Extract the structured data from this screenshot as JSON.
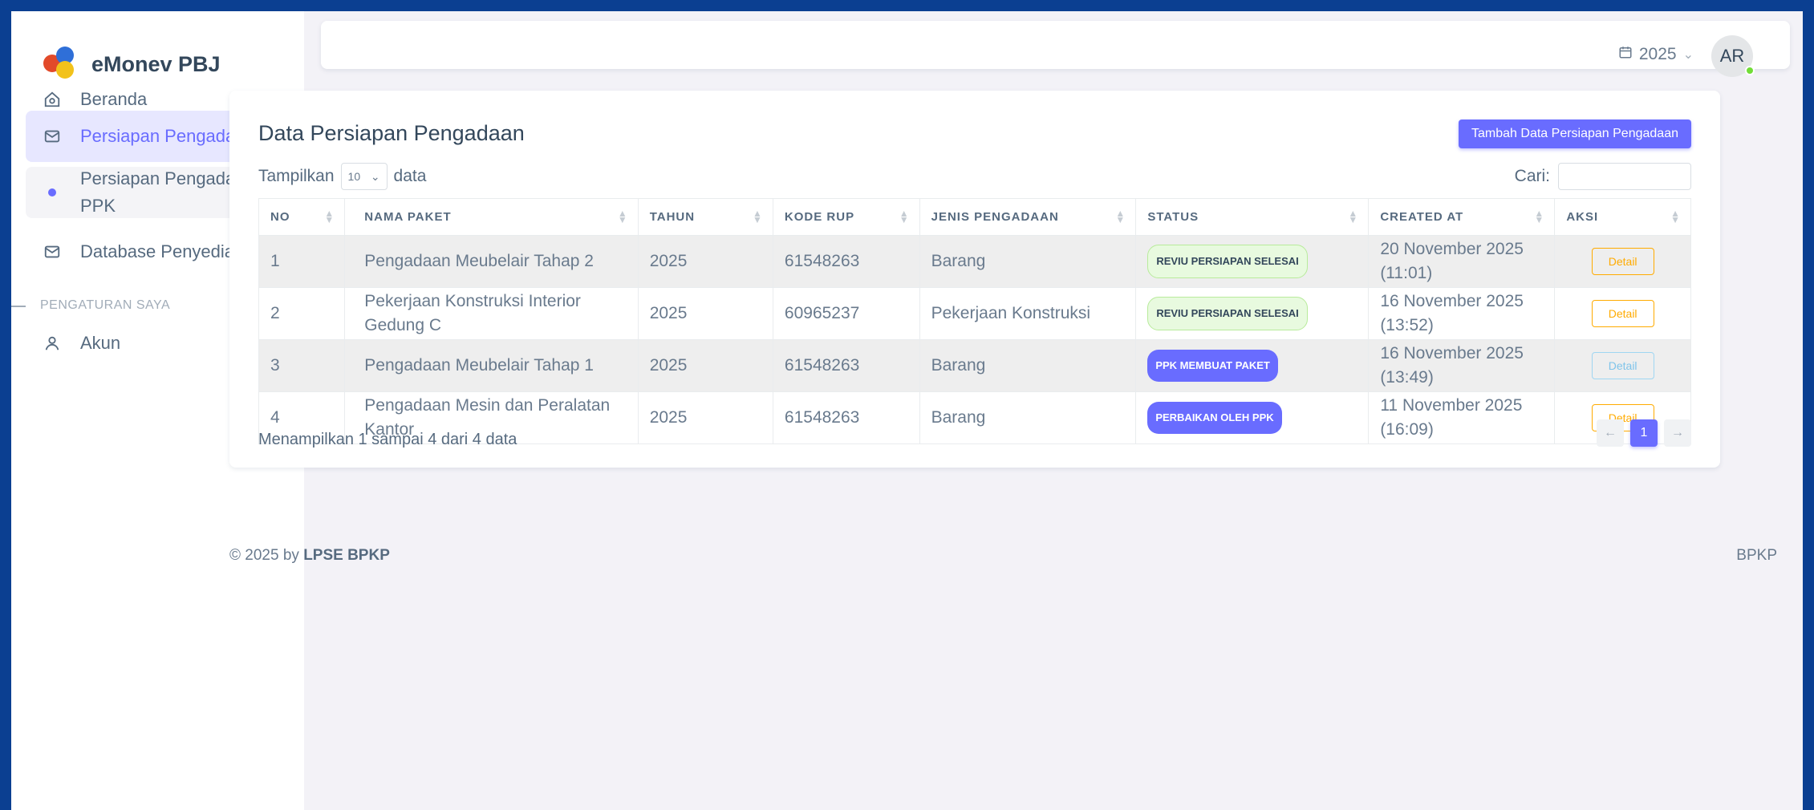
{
  "app": {
    "name": "eMonev PBJ"
  },
  "sidebar": {
    "items": [
      {
        "label": "Beranda",
        "icon": "home-icon"
      },
      {
        "label": "Persiapan Pengadaan",
        "icon": "mail-icon",
        "active": true
      },
      {
        "label": "Persiapan Pengadaan PPK",
        "icon": "dot"
      },
      {
        "label": "Database Penyedia",
        "icon": "mail-icon"
      }
    ],
    "section_title": "PENGATURAN SAYA",
    "account": {
      "label": "Akun",
      "icon": "user-icon"
    }
  },
  "topbar": {
    "year": "2025",
    "avatar_initials": "AR"
  },
  "card": {
    "title": "Data Persiapan Pengadaan",
    "add_button": "Tambah Data Persiapan Pengadaan",
    "show_prefix": "Tampilkan",
    "page_length": "10",
    "show_suffix": "data",
    "search_label": "Cari:",
    "columns": [
      "NO",
      "NAMA PAKET",
      "TAHUN",
      "KODE RUP",
      "JENIS PENGADAAN",
      "STATUS",
      "CREATED AT",
      "AKSI"
    ],
    "rows": [
      {
        "no": "1",
        "nama": "Pengadaan Meubelair Tahap 2",
        "tahun": "2025",
        "kode": "61548263",
        "jenis": "Barang",
        "status": "REVIU PERSIAPAN SELESAI",
        "created": "20 November 2025 (11:01)",
        "aksi": "Detail"
      },
      {
        "no": "2",
        "nama": "Pekerjaan Konstruksi Interior Gedung C",
        "tahun": "2025",
        "kode": "60965237",
        "jenis": "Pekerjaan Konstruksi",
        "status": "REVIU PERSIAPAN SELESAI",
        "created": "16 November 2025 (13:52)",
        "aksi": "Detail"
      },
      {
        "no": "3",
        "nama": "Pengadaan Meubelair Tahap 1",
        "tahun": "2025",
        "kode": "61548263",
        "jenis": "Barang",
        "status": "PPK MEMBUAT PAKET",
        "created": "16 November 2025 (13:49)",
        "aksi": "Detail"
      },
      {
        "no": "4",
        "nama": "Pengadaan Mesin dan Peralatan Kantor",
        "tahun": "2025",
        "kode": "61548263",
        "jenis": "Barang",
        "status": "PERBAIKAN OLEH PPK",
        "created": "11 November 2025 (16:09)",
        "aksi": "Detail"
      }
    ],
    "info": "Menampilkan 1 sampai 4 dari 4 data",
    "pagination": {
      "prev": "←",
      "current": "1",
      "next": "→"
    }
  },
  "footer": {
    "copyright": "© 2025 by",
    "org": "LPSE BPKP",
    "right": "BPKP"
  },
  "colors": {
    "primary": "#696cff",
    "success": "#71dd37",
    "warning": "#ffab00",
    "frame": "#0b3f91"
  }
}
